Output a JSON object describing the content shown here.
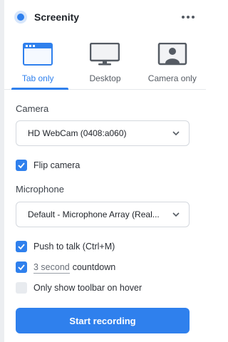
{
  "app": {
    "title": "Screenity",
    "accent": "#2f80ed"
  },
  "tabs": [
    {
      "label": "Tab only",
      "icon": "browser-tab-icon",
      "active": true
    },
    {
      "label": "Desktop",
      "icon": "monitor-icon",
      "active": false
    },
    {
      "label": "Camera only",
      "icon": "camera-user-icon",
      "active": false
    }
  ],
  "camera": {
    "label": "Camera",
    "selected": "HD WebCam (0408:a060)",
    "flip_label": "Flip camera",
    "flip_checked": true
  },
  "microphone": {
    "label": "Microphone",
    "selected": "Default - Microphone Array (Real..."
  },
  "options": {
    "push_to_talk_label": "Push to talk (Ctrl+M)",
    "push_to_talk_checked": true,
    "countdown_value": "3 second",
    "countdown_label": "countdown",
    "countdown_checked": true,
    "toolbar_hover_label": "Only show toolbar on hover",
    "toolbar_hover_checked": false
  },
  "actions": {
    "start_label": "Start recording"
  }
}
